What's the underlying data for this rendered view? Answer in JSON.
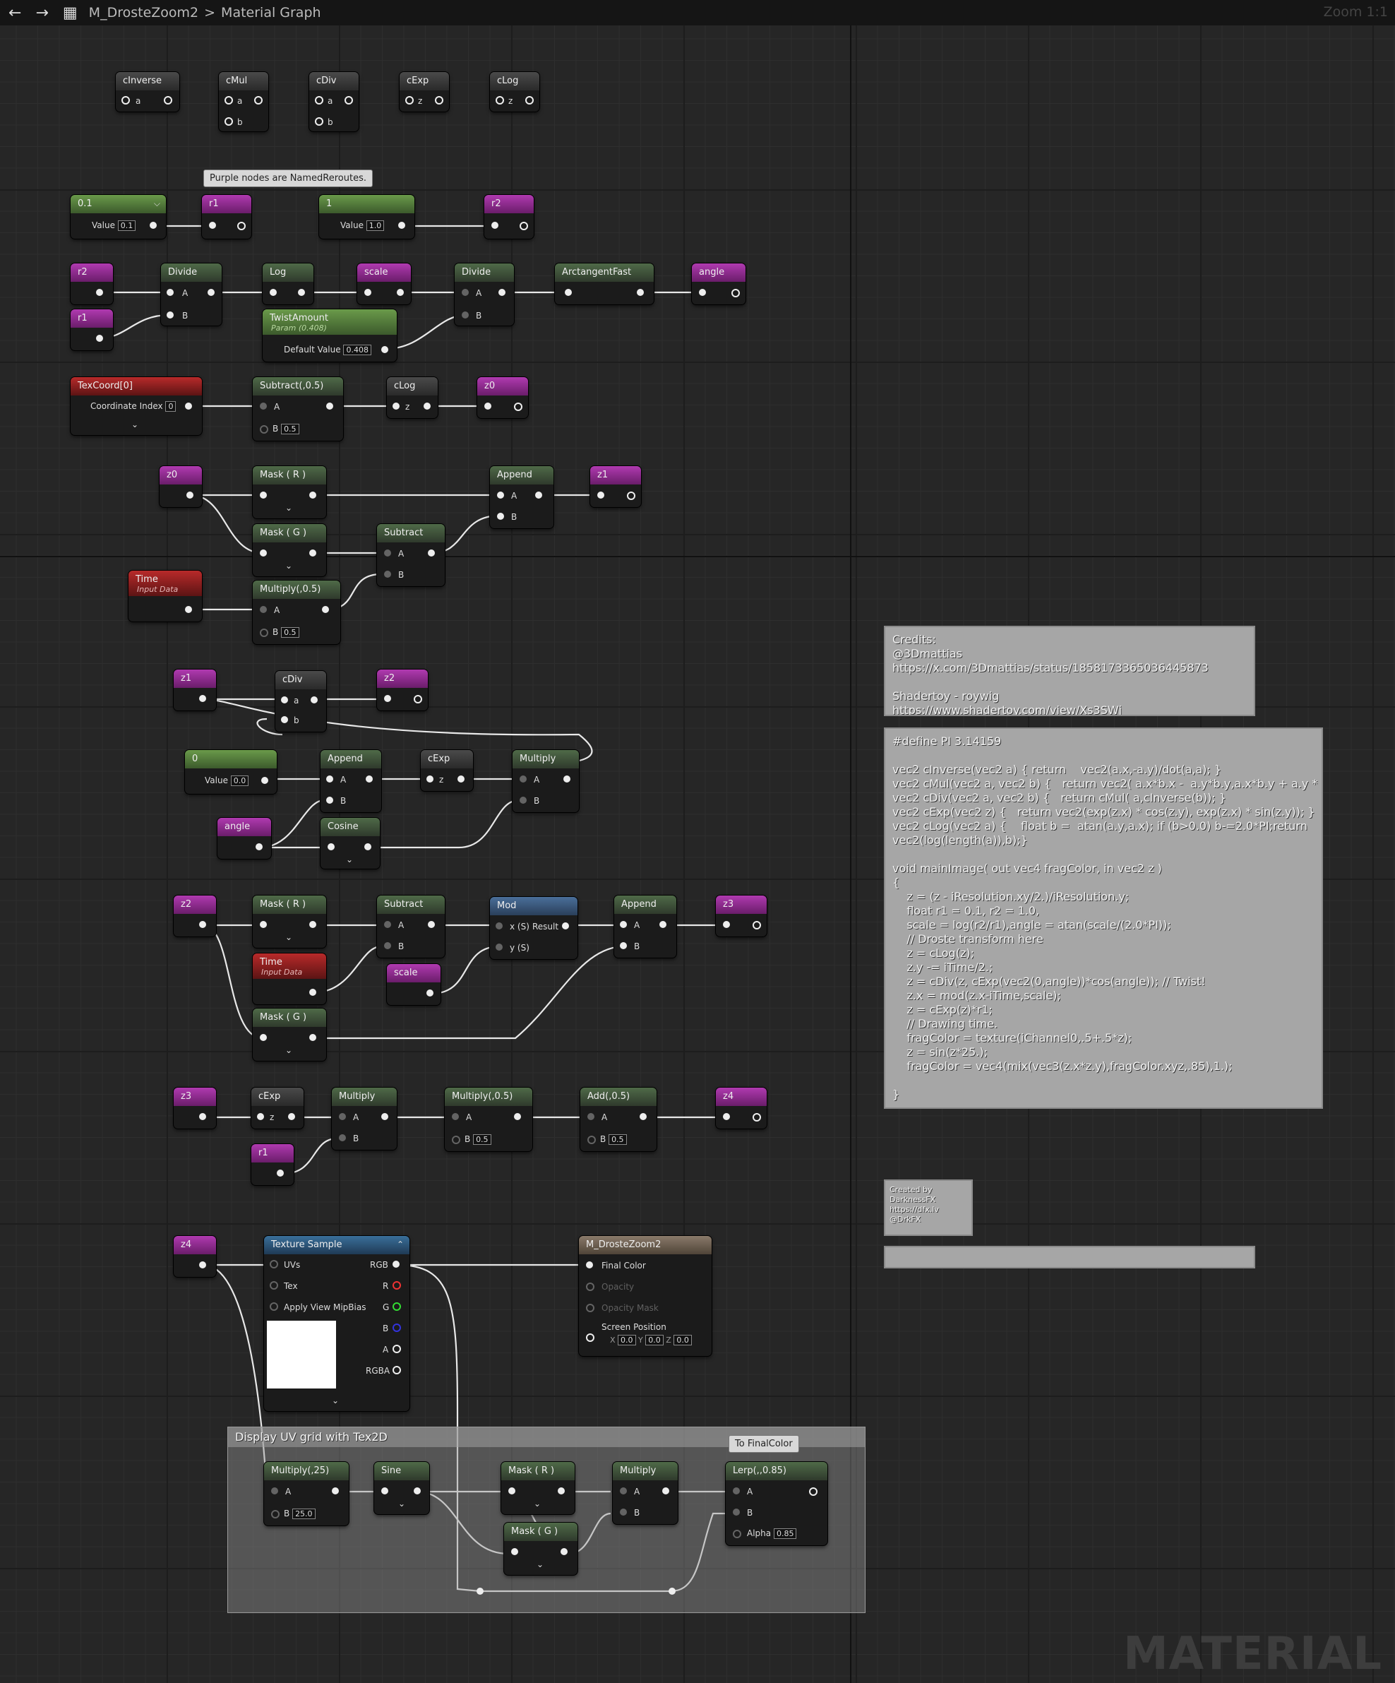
{
  "topbar": {
    "breadcrumb_asset": "M_DrosteZoom2",
    "breadcrumb_sep": ">",
    "breadcrumb_view": "Material Graph",
    "zoom": "Zoom 1:1"
  },
  "icons": {
    "back": "arrow-left-icon",
    "forward": "arrow-right-icon",
    "graph": "graph-tree-icon"
  },
  "bubbles": {
    "purple_note": "Purple nodes are NamedReroutes.",
    "final_color": "To FinalColor"
  },
  "nodes": {
    "cinverse": {
      "title": "cInverse",
      "in": "a"
    },
    "cmul": {
      "title": "cMul",
      "a": "a",
      "b": "b"
    },
    "cdiv_top": {
      "title": "cDiv",
      "a": "a",
      "b": "b"
    },
    "cexp_top": {
      "title": "cExp",
      "z": "z"
    },
    "clog_top": {
      "title": "cLog",
      "z": "z"
    },
    "const_01": {
      "title": "0.1",
      "label": "Value",
      "value": "0.1"
    },
    "r1_decl": {
      "title": "r1"
    },
    "const_1": {
      "title": "1",
      "label": "Value",
      "value": "1.0"
    },
    "r2_decl": {
      "title": "r2"
    },
    "r2_use": {
      "title": "r2"
    },
    "r1_use": {
      "title": "r1"
    },
    "divide_1": {
      "title": "Divide",
      "a": "A",
      "b": "B"
    },
    "log_1": {
      "title": "Log"
    },
    "scale_decl": {
      "title": "scale"
    },
    "divide_2": {
      "title": "Divide",
      "a": "A",
      "b": "B"
    },
    "atan": {
      "title": "ArctangentFast"
    },
    "angle_decl": {
      "title": "angle"
    },
    "twist": {
      "title": "TwistAmount",
      "sub": "Param (0.408)",
      "label": "Default Value",
      "value": "0.408"
    },
    "texcoord": {
      "title": "TexCoord[0]",
      "label": "Coordinate Index",
      "value": "0"
    },
    "sub_05": {
      "title": "Subtract(,0.5)",
      "a": "A",
      "b": "B",
      "bval": "0.5"
    },
    "clog_1": {
      "title": "cLog",
      "z": "z"
    },
    "z0_decl": {
      "title": "z0"
    },
    "z0_use": {
      "title": "z0"
    },
    "mask_r1": {
      "title": "Mask ( R )"
    },
    "mask_g1": {
      "title": "Mask ( G )"
    },
    "append_1": {
      "title": "Append",
      "a": "A",
      "b": "B"
    },
    "z1_decl": {
      "title": "z1"
    },
    "subtract_1": {
      "title": "Subtract",
      "a": "A",
      "b": "B"
    },
    "time_1": {
      "title": "Time",
      "sub": "Input Data"
    },
    "mul_05": {
      "title": "Multiply(,0.5)",
      "a": "A",
      "b": "B",
      "bval": "0.5"
    },
    "z1_use": {
      "title": "z1"
    },
    "cdiv_1": {
      "title": "cDiv",
      "a": "a",
      "b": "b"
    },
    "z2_decl": {
      "title": "z2"
    },
    "const_0": {
      "title": "0",
      "label": "Value",
      "value": "0.0"
    },
    "append_2": {
      "title": "Append",
      "a": "A",
      "b": "B"
    },
    "cexp_1": {
      "title": "cExp",
      "z": "z"
    },
    "multiply_1": {
      "title": "Multiply",
      "a": "A",
      "b": "B"
    },
    "angle_use": {
      "title": "angle"
    },
    "cosine": {
      "title": "Cosine"
    },
    "z2_use": {
      "title": "z2"
    },
    "mask_r2": {
      "title": "Mask ( R )"
    },
    "subtract_2": {
      "title": "Subtract",
      "a": "A",
      "b": "B"
    },
    "mod": {
      "title": "Mod",
      "x": "x (S)",
      "y": "y (S)",
      "result": "Result"
    },
    "append_3": {
      "title": "Append",
      "a": "A",
      "b": "B"
    },
    "z3_decl": {
      "title": "z3"
    },
    "time_2": {
      "title": "Time",
      "sub": "Input Data"
    },
    "scale_use": {
      "title": "scale"
    },
    "mask_g2": {
      "title": "Mask ( G )"
    },
    "z3_use": {
      "title": "z3"
    },
    "cexp_2": {
      "title": "cExp",
      "z": "z"
    },
    "multiply_2": {
      "title": "Multiply",
      "a": "A",
      "b": "B"
    },
    "mul_05b": {
      "title": "Multiply(,0.5)",
      "a": "A",
      "b": "B",
      "bval": "0.5"
    },
    "add_05": {
      "title": "Add(,0.5)",
      "a": "A",
      "b": "B",
      "bval": "0.5"
    },
    "z4_decl": {
      "title": "z4"
    },
    "r1_use2": {
      "title": "r1"
    },
    "z4_use": {
      "title": "z4"
    },
    "texsample": {
      "title": "Texture Sample",
      "uvs": "UVs",
      "tex": "Tex",
      "mip": "Apply View MipBias",
      "rgb": "RGB",
      "r": "R",
      "g": "G",
      "b": "B",
      "a": "A",
      "rgba": "RGBA"
    },
    "material": {
      "title": "M_DrosteZoom2",
      "final": "Final Color",
      "opacity": "Opacity",
      "mask": "Opacity Mask",
      "screen": "Screen Position",
      "x": "X",
      "xv": "0.0",
      "y": "Y",
      "yv": "0.0",
      "z": "Z",
      "zv": "0.0"
    },
    "mul_25": {
      "title": "Multiply(,25)",
      "a": "A",
      "b": "B",
      "bval": "25.0"
    },
    "sine": {
      "title": "Sine"
    },
    "mask_r3": {
      "title": "Mask ( R )"
    },
    "multiply_3": {
      "title": "Multiply",
      "a": "A",
      "b": "B"
    },
    "lerp": {
      "title": "Lerp(,,0.85)",
      "a": "A",
      "b": "B",
      "alpha": "Alpha",
      "alphav": "0.85"
    },
    "mask_g3": {
      "title": "Mask ( G )"
    }
  },
  "comments": {
    "credits": "Credits:\n@3Dmattias\nhttps://x.com/3Dmattias/status/1858173365036445873\n\nShadertoy - roywig\nhttps://www.shadertoy.com/view/Xs3SWj",
    "code": "#define PI 3.14159\n\nvec2 cInverse(vec2 a) { return    vec2(a.x,-a.y)/dot(a,a); }\nvec2 cMul(vec2 a, vec2 b) {   return vec2( a.x*b.x -  a.y*b.y,a.x*b.y + a.y * b.x); }\nvec2 cDiv(vec2 a, vec2 b) {   return cMul( a,cInverse(b)); }\nvec2 cExp(vec2 z) {   return vec2(exp(z.x) * cos(z.y), exp(z.x) * sin(z.y)); }\nvec2 cLog(vec2 a) {    float b =  atan(a.y,a.x); if (b>0.0) b-=2.0*PI;return\nvec2(log(length(a)),b);}\n\nvoid mainImage( out vec4 fragColor, in vec2 z )\n{\n    z = (z - iResolution.xy/2.)/iResolution.y;\n    float r1 = 0.1, r2 = 1.0,\n    scale = log(r2/r1),angle = atan(scale/(2.0*PI));\n    // Droste transform here\n    z = cLog(z);\n    z.y -= iTime/2.;\n    z = cDiv(z, cExp(vec2(0,angle))*cos(angle)); // Twist!\n    z.x = mod(z.x-iTime,scale);\n    z = cExp(z)*r1;\n    // Drawing time.\n    fragColor = texture(iChannel0,.5+.5*z);\n    z = sin(z*25.);\n    fragColor = vec4(mix(vec3(z.x*z.y),fragColor.xyz,.85),1.);\n\n}",
    "created": "Created by\nDarknessFX\nhttps://dfx.lv\n@DrkFX",
    "blank": ""
  },
  "group": {
    "title": "Display UV grid with Tex2D"
  },
  "watermark": "MATERIAL"
}
